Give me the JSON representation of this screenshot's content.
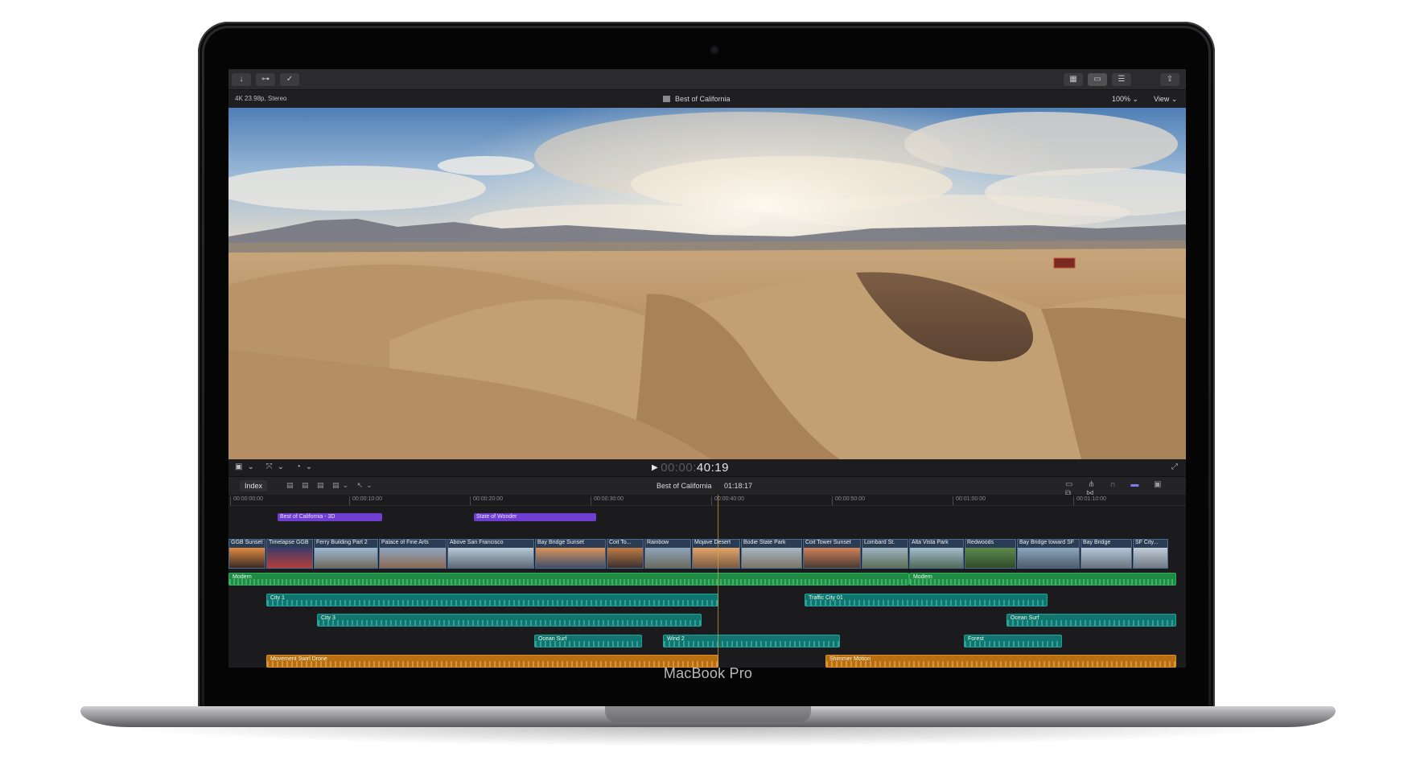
{
  "device": {
    "brand_label": "MacBook Pro"
  },
  "toolbar": {
    "left_buttons": [
      "↓",
      "⊶",
      "✓"
    ],
    "right_buttons": [
      "▦",
      "▭",
      "☰",
      "⇪"
    ]
  },
  "viewer": {
    "format_info": "4K 23.98p, Stereo",
    "project_title": "Best of California",
    "zoom_label": "100% ⌄",
    "view_label": "View ⌄"
  },
  "playback": {
    "play_icon": "▶",
    "timecode_dim": "00:00:",
    "timecode_bright": "40:19"
  },
  "timeline_header": {
    "index_label": "Index",
    "project_name": "Best of California",
    "duration": "01:18:17"
  },
  "ruler": {
    "ticks": [
      "00:00:00:00",
      "00:00:10:00",
      "00:00:20:00",
      "00:00:30:00",
      "00:00:40:00",
      "00:00:50:00",
      "00:01:00:00",
      "00:01:10:00"
    ]
  },
  "markers": [
    "Best of California - 3D",
    "State of Wonder"
  ],
  "video_clips": [
    "GGB Sunset",
    "Timelapse GGB",
    "Ferry Building Part 2",
    "Palace of Fine Arts",
    "Above San Francisco",
    "Bay Bridge Sunset",
    "Coit To...",
    "Rainbow",
    "Mojave Desert",
    "Bodie State Park",
    "Coit Tower Sunset",
    "Lombard St.",
    "Alta Vista Park",
    "Redwoods",
    "Bay Bridge toward SF",
    "Bay Bridge",
    "SF City..."
  ],
  "audio_clips": [
    {
      "label": "Modern",
      "color": "green"
    },
    {
      "label": "Modern",
      "color": "green"
    },
    {
      "label": "City 1",
      "color": "teal"
    },
    {
      "label": "Traffic City 01",
      "color": "teal"
    },
    {
      "label": "City 3",
      "color": "teal"
    },
    {
      "label": "Ocean Surf",
      "color": "teal"
    },
    {
      "label": "Ocean Surf",
      "color": "teal"
    },
    {
      "label": "Wind 2",
      "color": "teal"
    },
    {
      "label": "Forest",
      "color": "teal"
    },
    {
      "label": "Movement Swirl Drone",
      "color": "orange"
    },
    {
      "label": "Shimmer Motion",
      "color": "orange"
    }
  ],
  "colors": {
    "marker": "#6e3fd1",
    "music": "#1f8a44",
    "sfx": "#11746f",
    "titles": "#b86e12",
    "playhead": "#c9a94a"
  }
}
